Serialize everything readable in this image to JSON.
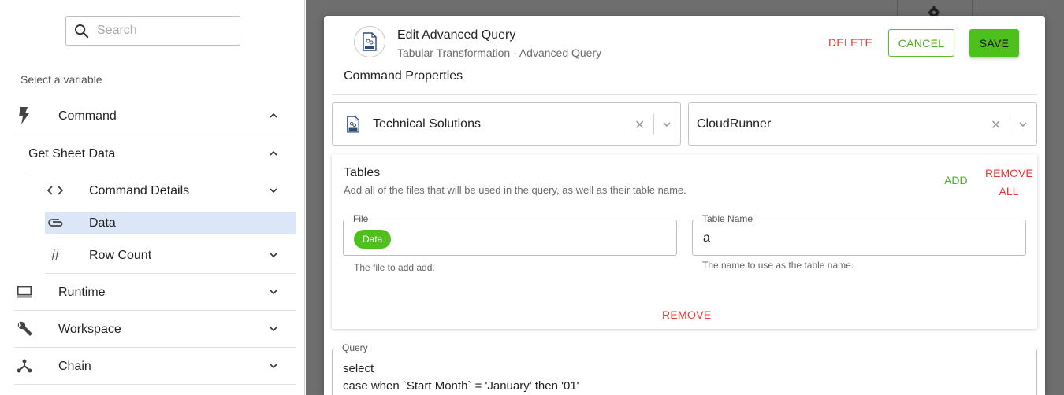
{
  "sidebar": {
    "search_placeholder": "Search",
    "select_variable_label": "Select a variable",
    "items": [
      {
        "label": "Command",
        "icon": "lightning-icon",
        "expanded": true
      },
      {
        "label": "Get Sheet Data",
        "expanded": true
      },
      {
        "label": "Command Details",
        "icon": "code-icon",
        "expanded": false
      },
      {
        "label": "Data",
        "icon": "paperclip-icon",
        "selected": true
      },
      {
        "label": "Row Count",
        "icon": "hash-icon",
        "expanded": false
      },
      {
        "label": "Runtime",
        "icon": "laptop-icon",
        "expanded": false
      },
      {
        "label": "Workspace",
        "icon": "wrench-icon",
        "expanded": false
      },
      {
        "label": "Chain",
        "icon": "chain-icon",
        "expanded": false
      }
    ]
  },
  "modal": {
    "title": "Edit Advanced Query",
    "subtitle": "Tabular Transformation - Advanced Query",
    "delete_label": "DELETE",
    "cancel_label": "CANCEL",
    "save_label": "SAVE",
    "command_properties_label": "Command Properties",
    "select_left": "Technical Solutions",
    "select_right": "CloudRunner",
    "tables": {
      "title": "Tables",
      "description": "Add all of the files that will be used in the query, as well as their table name.",
      "add_label": "ADD",
      "remove_all_line1": "REMOVE",
      "remove_all_line2": "ALL",
      "file_legend": "File",
      "file_chip": "Data",
      "file_helper": "The file to add add.",
      "table_name_legend": "Table Name",
      "table_name_value": "a",
      "table_name_helper": "The name to use as the table name.",
      "remove_label": "REMOVE"
    },
    "query": {
      "legend": "Query",
      "line1": "select",
      "line2": "case when `Start Month` = 'January' then '01'"
    }
  },
  "colors": {
    "accent_green": "#4ec01c",
    "danger_red": "#e53935",
    "selected_bg": "#dbe7f8",
    "overlay": "#6e6e6e"
  }
}
